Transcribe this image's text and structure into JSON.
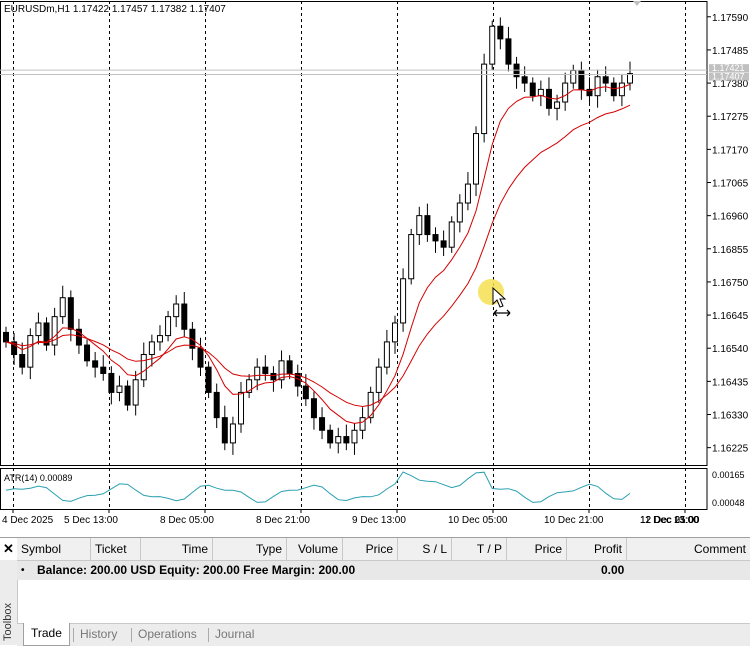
{
  "chart": {
    "title": "EURUSDm,H1  1.17422 1.17457 1.17382 1.17407",
    "price_labels": [
      "1.17590",
      "1.17485",
      "1.17380",
      "1.17275",
      "1.17170",
      "1.17065",
      "1.16960",
      "1.16855",
      "1.16750",
      "1.16645",
      "1.16540",
      "1.16435",
      "1.16330",
      "1.16225"
    ],
    "current_price_labels": [
      "1.17421",
      "1.17407"
    ],
    "indicator_title": "ATR(14) 0.00089",
    "indicator_labels": [
      "0.00165",
      "0.00048"
    ],
    "time_labels": [
      "4 Dec 2025",
      "5 Dec 13:00",
      "8 Dec 05:00",
      "8 Dec 21:00",
      "9 Dec 13:00",
      "10 Dec 05:00",
      "10 Dec 21:00",
      "11 Dec 13:00",
      "12 Dec 05:00",
      "12 Dec 21:00"
    ],
    "colors": {
      "candle": "#000000",
      "ma_fast": "#d40000",
      "ma_slow": "#d40000",
      "atr": "#2aa0b0",
      "grid": "#000000",
      "cursor_highlight": "#f5e050"
    }
  },
  "chart_data": {
    "type": "candlestick",
    "symbol": "EURUSDm",
    "timeframe": "H1",
    "ylim": [
      1.1617,
      1.1764
    ],
    "closes": [
      1.1656,
      1.1652,
      1.1648,
      1.1658,
      1.1662,
      1.1655,
      1.1664,
      1.167,
      1.166,
      1.1655,
      1.165,
      1.1648,
      1.1646,
      1.164,
      1.1642,
      1.1636,
      1.1644,
      1.1652,
      1.1656,
      1.1658,
      1.1664,
      1.1668,
      1.166,
      1.1654,
      1.1648,
      1.164,
      1.1632,
      1.1624,
      1.163,
      1.164,
      1.1644,
      1.1648,
      1.1646,
      1.1644,
      1.165,
      1.1646,
      1.1642,
      1.1638,
      1.1632,
      1.1628,
      1.1624,
      1.1626,
      1.1624,
      1.1628,
      1.1632,
      1.164,
      1.1648,
      1.1656,
      1.1662,
      1.1676,
      1.169,
      1.1696,
      1.169,
      1.1688,
      1.1686,
      1.1694,
      1.17,
      1.1706,
      1.1722,
      1.1744,
      1.1756,
      1.1752,
      1.1744,
      1.174,
      1.1738,
      1.1734,
      1.1736,
      1.173,
      1.1732,
      1.1738,
      1.1742,
      1.1736,
      1.1734,
      1.174,
      1.1738,
      1.1734,
      1.1738,
      1.1741
    ],
    "indicator": {
      "name": "ATR(14)",
      "value": 0.00089,
      "ylim": [
        0.00048,
        0.00165
      ]
    }
  },
  "toolbox": {
    "close_label": "✕",
    "side_label": "Toolbox",
    "columns": [
      "Symbol",
      "Ticket",
      "Time",
      "Type",
      "Volume",
      "Price",
      "S / L",
      "T / P",
      "Price",
      "Profit",
      "Comment"
    ],
    "balance_text": "Balance: 200.00 USD  Equity: 200.00  Free Margin: 200.00",
    "balance_profit": "0.00",
    "tabs": [
      "Trade",
      "History",
      "Operations",
      "Journal"
    ]
  }
}
